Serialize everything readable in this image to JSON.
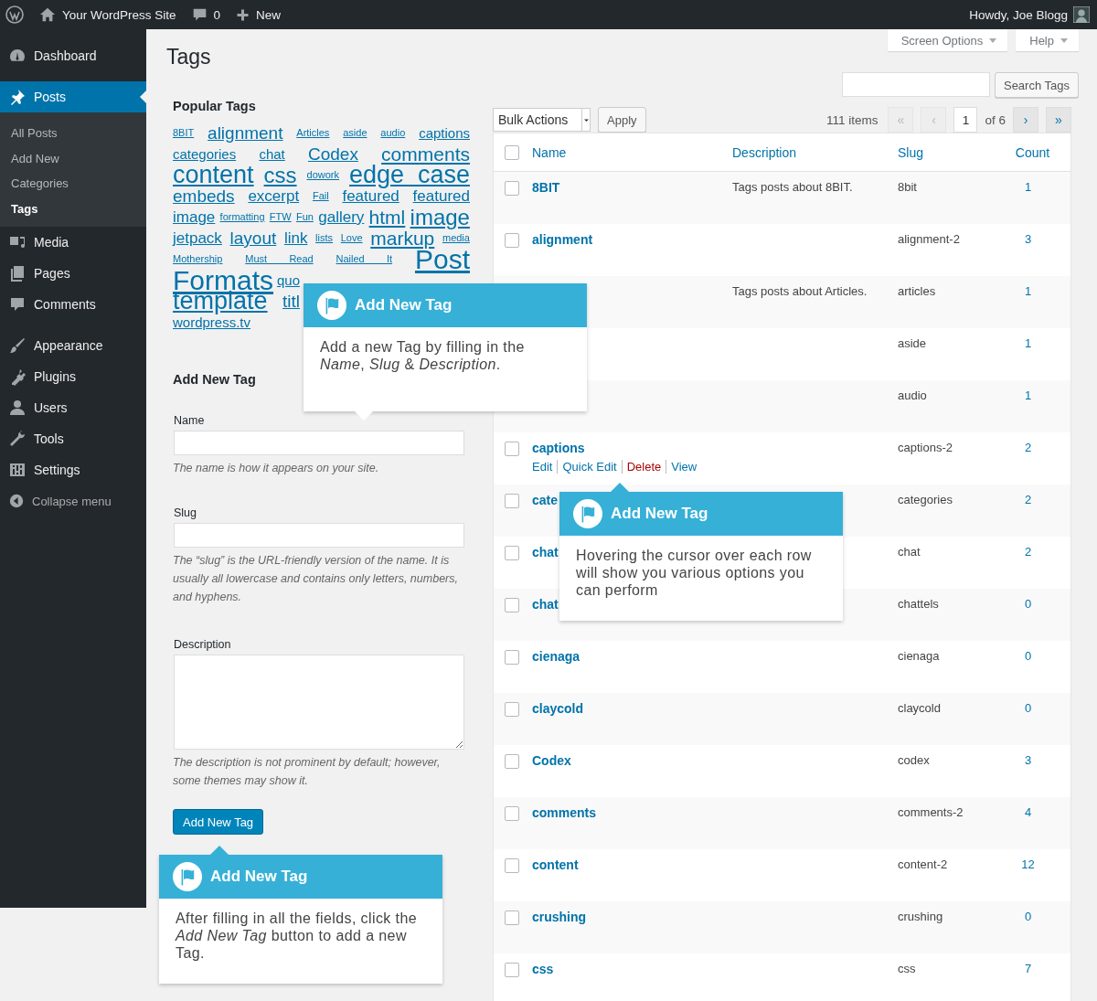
{
  "admin_bar": {
    "site_name": "Your WordPress Site",
    "comments_count": "0",
    "new_label": "New",
    "greeting": "Howdy, Joe Blogg"
  },
  "sidebar": {
    "items": [
      {
        "label": "Dashboard",
        "selected": false
      },
      {
        "label": "Posts",
        "selected": true,
        "children": [
          {
            "label": "All Posts",
            "selected": false
          },
          {
            "label": "Add New",
            "selected": false
          },
          {
            "label": "Categories",
            "selected": false
          },
          {
            "label": "Tags",
            "selected": true
          }
        ]
      },
      {
        "label": "Media",
        "selected": false
      },
      {
        "label": "Pages",
        "selected": false
      },
      {
        "label": "Comments",
        "selected": false
      },
      {
        "label": "Appearance",
        "selected": false
      },
      {
        "label": "Plugins",
        "selected": false
      },
      {
        "label": "Users",
        "selected": false
      },
      {
        "label": "Tools",
        "selected": false
      },
      {
        "label": "Settings",
        "selected": false
      }
    ],
    "collapse_label": "Collapse menu"
  },
  "screen_tabs": [
    "Screen Options",
    "Help"
  ],
  "page_title": "Tags",
  "popular_tags": {
    "heading": "Popular Tags",
    "tags": [
      {
        "label": "8BIT",
        "kind": "xs"
      },
      {
        "label": "alignment",
        "kind": "l"
      },
      {
        "label": "Articles",
        "kind": "xs"
      },
      {
        "label": "aside",
        "kind": "xs"
      },
      {
        "label": "audio",
        "kind": "xs"
      },
      {
        "label": "captions",
        "kind": "s"
      },
      {
        "label": "categories",
        "kind": "s"
      },
      {
        "label": "chat",
        "kind": "s"
      },
      {
        "label": "Codex",
        "kind": "l"
      },
      {
        "label": "comments",
        "kind": "xl"
      },
      {
        "label": "content",
        "kind": "xxxl"
      },
      {
        "label": "css",
        "kind": "xxl"
      },
      {
        "label": "dowork",
        "kind": "xs"
      },
      {
        "label": "edge case",
        "kind": "xxxl"
      },
      {
        "label": "embeds",
        "kind": "l"
      },
      {
        "label": "excerpt",
        "kind": "m"
      },
      {
        "label": "Fail",
        "kind": "xs"
      },
      {
        "label": "featured",
        "kind": "m"
      },
      {
        "label": "featured",
        "kind": "m"
      },
      {
        "label": "image",
        "kind": "m"
      },
      {
        "label": "formatting",
        "kind": "xs"
      },
      {
        "label": "FTW",
        "kind": "xs"
      },
      {
        "label": "Fun",
        "kind": "xs"
      },
      {
        "label": "gallery",
        "kind": "m"
      },
      {
        "label": "html",
        "kind": "xl"
      },
      {
        "label": "image",
        "kind": "xxl"
      },
      {
        "label": "jetpack",
        "kind": "m"
      },
      {
        "label": "layout",
        "kind": "l"
      },
      {
        "label": "link",
        "kind": "m"
      },
      {
        "label": "lists",
        "kind": "xs"
      },
      {
        "label": "Love",
        "kind": "xs"
      },
      {
        "label": "markup",
        "kind": "xl"
      },
      {
        "label": "media",
        "kind": "xs"
      },
      {
        "label": "Mothership",
        "kind": "xs"
      },
      {
        "label": "Must Read",
        "kind": "xs"
      },
      {
        "label": "Nailed It",
        "kind": "xs"
      },
      {
        "label": "Post",
        "kind": "max"
      },
      {
        "label": "Formats",
        "kind": "max"
      },
      {
        "label": "quo",
        "kind": "s"
      },
      {
        "label": "template",
        "kind": "xxxl"
      },
      {
        "label": "titl",
        "kind": "l"
      },
      {
        "label": "wordpress.tv",
        "kind": "s"
      }
    ]
  },
  "add_form": {
    "heading": "Add New Tag",
    "fields": [
      {
        "kind": "input",
        "label": "Name",
        "hint": "The name is how it appears on your site."
      },
      {
        "kind": "input",
        "label": "Slug",
        "hint": "The “slug” is the URL-friendly version of the name. It is usually all lowercase and contains only letters, numbers, and hyphens."
      },
      {
        "kind": "textarea",
        "label": "Description",
        "hint": "The description is not prominent by default; however, some themes may show it."
      }
    ],
    "submit": "Add New Tag"
  },
  "search": {
    "button": "Search Tags"
  },
  "tablenav": {
    "bulk_action": "Bulk Actions",
    "apply": "Apply",
    "items_count": "111 items",
    "first": {
      "label": "«",
      "disabled": true
    },
    "prev": {
      "label": "‹",
      "disabled": true
    },
    "page": "1",
    "of_pages": "of 6",
    "next": {
      "label": "›",
      "disabled": false
    },
    "last": {
      "label": "»",
      "disabled": false
    }
  },
  "table": {
    "columns": [
      "Name",
      "Description",
      "Slug",
      "Count"
    ],
    "all_checked": false,
    "rows": [
      {
        "name": "8BIT",
        "checked": false,
        "description": "Tags posts about 8BIT.",
        "slug": "8bit",
        "count": "1"
      },
      {
        "name": "alignment",
        "checked": false,
        "slug": "alignment-2",
        "count": "3"
      },
      {
        "description": "Tags posts about Articles.",
        "slug": "articles",
        "count": "1"
      },
      {
        "slug": "aside",
        "count": "1"
      },
      {
        "slug": "audio",
        "count": "1"
      },
      {
        "name": "captions",
        "checked": false,
        "slug": "captions-2",
        "count": "2",
        "actions": [
          {
            "label": "Edit",
            "kind": "normal"
          },
          {
            "label": "Quick Edit",
            "kind": "normal"
          },
          {
            "label": "Delete",
            "kind": "danger"
          },
          {
            "label": "View",
            "kind": "normal"
          }
        ]
      },
      {
        "name": "cate",
        "checked": false,
        "slug": "categories",
        "count": "2"
      },
      {
        "name": "chat",
        "checked": false,
        "slug": "chat",
        "count": "2"
      },
      {
        "name": "chat",
        "checked": false,
        "slug": "chattels",
        "count": "0"
      },
      {
        "name": "cienaga",
        "checked": false,
        "slug": "cienaga",
        "count": "0"
      },
      {
        "name": "claycold",
        "checked": false,
        "slug": "claycold",
        "count": "0"
      },
      {
        "name": "Codex",
        "checked": false,
        "slug": "codex",
        "count": "3"
      },
      {
        "name": "comments",
        "checked": false,
        "slug": "comments-2",
        "count": "4"
      },
      {
        "name": "content",
        "checked": false,
        "slug": "content-2",
        "count": "12"
      },
      {
        "name": "crushing",
        "checked": false,
        "slug": "crushing",
        "count": "0"
      },
      {
        "name": "css",
        "checked": false,
        "slug": "css",
        "count": "7"
      }
    ]
  },
  "tooltips": [
    {
      "title": "Add New Tag",
      "text": "Add a new Tag by filling in the *Name*, *Slug* & *Description*."
    },
    {
      "title": "Add New Tag",
      "text": "Hovering the cursor over each row will show you various options you can perform"
    },
    {
      "title": "Add New Tag",
      "text": "After filling in all the fields, click the *Add New Tag* button to add a new Tag."
    }
  ]
}
